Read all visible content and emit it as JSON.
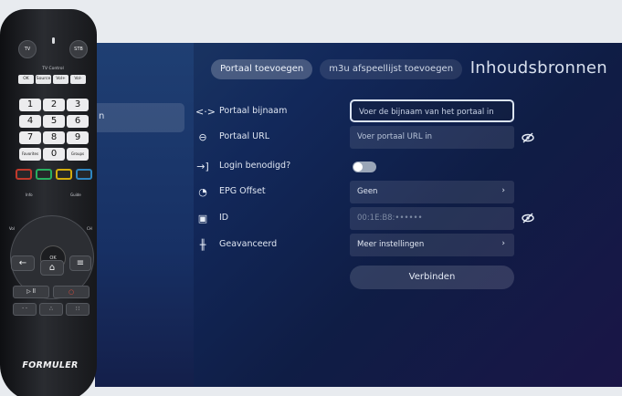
{
  "sidebar": {
    "selected_label": "n"
  },
  "tabs": [
    {
      "label": "Portaal toevoegen",
      "active": true
    },
    {
      "label": "m3u afspeellijst toevoegen",
      "active": false
    }
  ],
  "page_title": "Inhoudsbronnen",
  "form": {
    "portal_name": {
      "label": "Portaal bijnaam",
      "placeholder": "Voer de bijnaam van het portaal in"
    },
    "portal_url": {
      "label": "Portaal URL",
      "placeholder": "Voer portaal URL in"
    },
    "login": {
      "label": "Login benodigd?",
      "enabled": false
    },
    "epg_offset": {
      "label": "EPG Offset",
      "value": "Geen"
    },
    "id": {
      "label": "ID",
      "value": "00:1E:B8:••••••"
    },
    "advanced": {
      "label": "Geavanceerd",
      "value": "Meer instellingen"
    },
    "connect_label": "Verbinden"
  },
  "remote": {
    "power_label": "TV",
    "stb_label": "STB",
    "tv_control_label": "TV Control",
    "top_buttons": [
      "OK",
      "Source",
      "Vol+",
      "Vol-"
    ],
    "numbers": [
      "1",
      "2",
      "3",
      "4",
      "5",
      "6",
      "7",
      "8",
      "9"
    ],
    "extra_row": [
      "Favorites",
      "0",
      "Groups"
    ],
    "colors": [
      "#c0392b",
      "#27ae60",
      "#d4ac0d",
      "#2e86c1"
    ],
    "info_label": "Info",
    "guide_label": "Guide",
    "ok_label": "OK",
    "vol_label": "Vol",
    "ch_label": "CH",
    "brand": "FORMULER"
  }
}
